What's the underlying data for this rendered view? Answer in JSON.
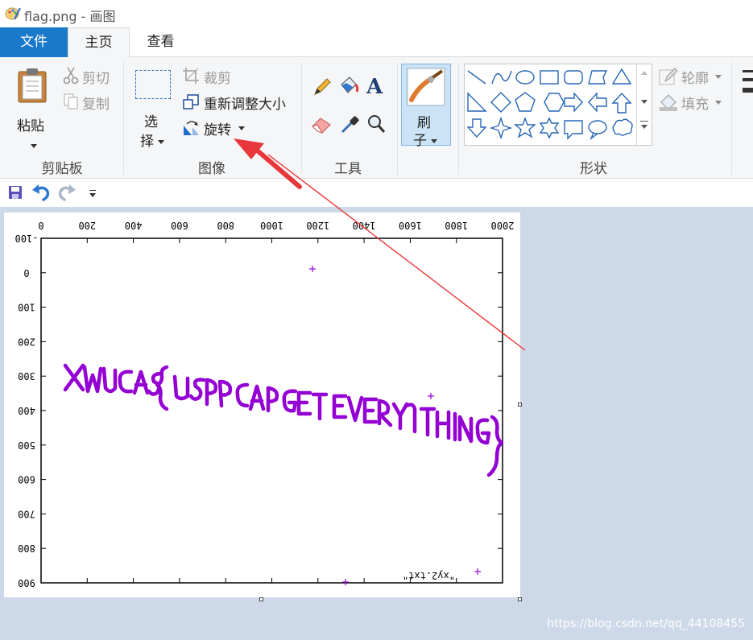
{
  "window": {
    "title": "flag.png - 画图"
  },
  "tabs": {
    "file": "文件",
    "home": "主页",
    "view": "查看"
  },
  "clipboard": {
    "paste": "粘贴",
    "cut": "剪切",
    "copy": "复制",
    "group_label": "剪贴板"
  },
  "image": {
    "select_line1": "选",
    "select_line2": "择",
    "crop": "裁剪",
    "resize": "重新调整大小",
    "rotate": "旋转",
    "group_label": "图像"
  },
  "tools": {
    "text_glyph": "A",
    "group_label": "工具"
  },
  "brushes": {
    "label_line1": "刷",
    "label_line2": "子"
  },
  "shapes": {
    "group_label": "形状",
    "outline": "轮廓",
    "fill": "填充"
  },
  "colors": {
    "ribbon_accent": "#1979ca",
    "plot_purple": "#9400d3",
    "arrow_red": "#e8373a",
    "canvas_bg": "#cdd8e8"
  },
  "plot": {
    "x_ticks": [
      "0",
      "200",
      "400",
      "600",
      "800",
      "1000",
      "1200",
      "1400",
      "1600",
      "1800",
      "2000"
    ],
    "y_ticks": [
      "-100",
      "0",
      "100",
      "200",
      "300",
      "400",
      "500",
      "600",
      "700",
      "800",
      "900"
    ],
    "legend": "\"xy2.txt\"",
    "flag_text": "XWUCAS{USBPCAPGETEVERYTHING}"
  },
  "watermark": "https://blog.csdn.net/qq_44108455"
}
